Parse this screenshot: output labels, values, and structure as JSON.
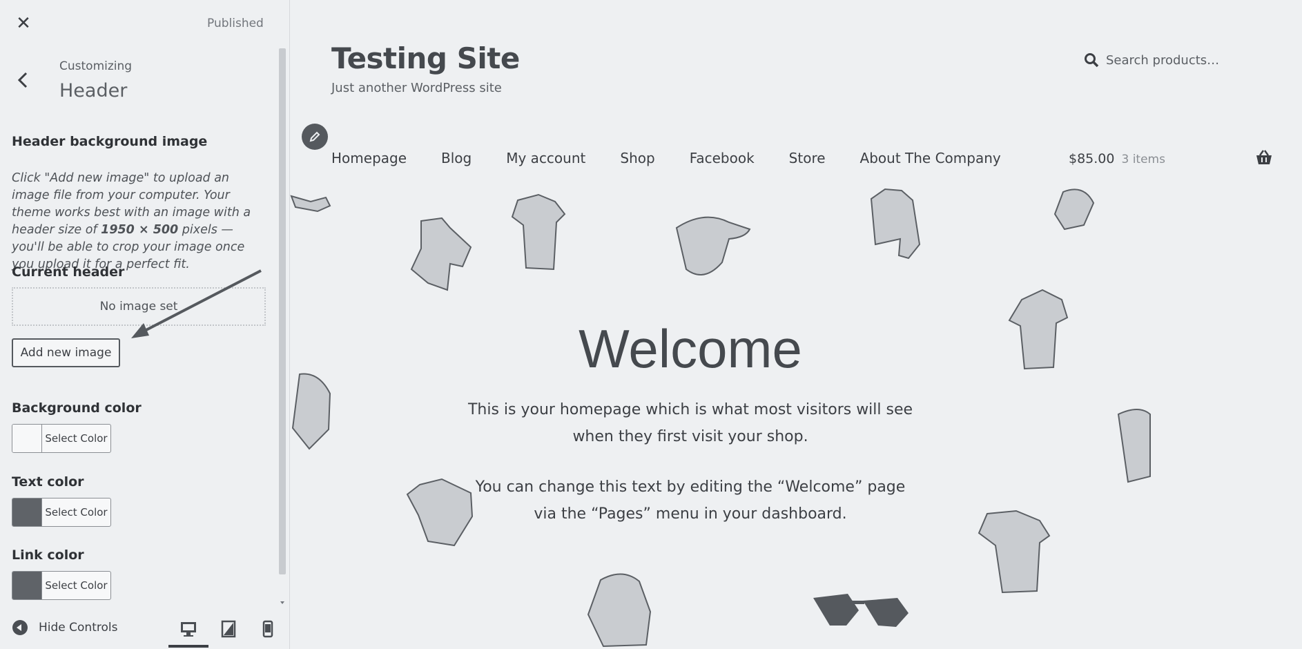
{
  "sidebar": {
    "close_label": "✕",
    "status": "Published",
    "breadcrumb": "Customizing",
    "section_title": "Header",
    "header_bg": {
      "title": "Header background image",
      "desc_part1": "Click \"Add new image\" to upload an image file from your computer. Your theme works best with an image with a header size of ",
      "desc_bold": "1950 × 500",
      "desc_part2": " pixels — you'll be able to crop your image once you upload it for a perfect fit."
    },
    "current_header": {
      "title": "Current header",
      "placeholder": "No image set",
      "add_button": "Add new image"
    },
    "colors": [
      {
        "title": "Background color",
        "button": "Select Color",
        "swatch": "#f7f8f9"
      },
      {
        "title": "Text color",
        "button": "Select Color",
        "swatch": "#5f6368"
      },
      {
        "title": "Link color",
        "button": "Select Color",
        "swatch": "#5f6368"
      }
    ],
    "footer": {
      "hide_controls": "Hide Controls",
      "devices": [
        "desktop-icon",
        "tablet-icon",
        "mobile-icon"
      ],
      "active_device": "desktop"
    }
  },
  "preview": {
    "site_title": "Testing Site",
    "tagline": "Just another WordPress site",
    "search_placeholder": "Search products…",
    "nav": [
      "Homepage",
      "Blog",
      "My account",
      "Shop",
      "Facebook",
      "Store",
      "About The Company"
    ],
    "cart_total": "$85.00",
    "cart_items": "3 items",
    "hero": {
      "title": "Welcome",
      "p1": "This is your homepage which is what most visitors will see when they first visit your shop.",
      "p2": "You can change this text by editing the “Welcome” page via the “Pages” menu in your dashboard."
    }
  },
  "colors": {
    "background": "#eef0f2",
    "text": "#3c3f44",
    "accent": "#55595e"
  }
}
